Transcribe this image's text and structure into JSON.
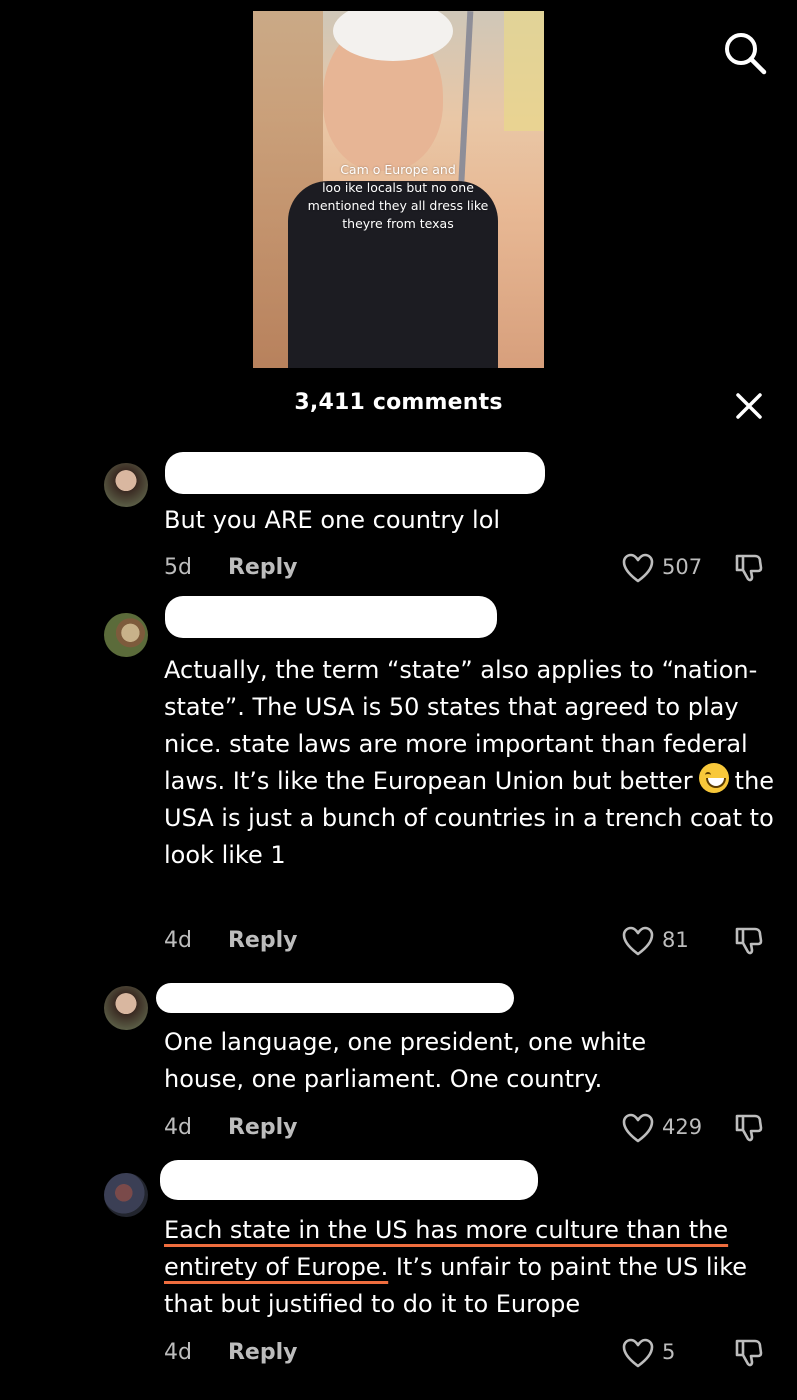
{
  "video": {
    "caption_lines": [
      "Cam  o Europe and",
      "loo  ike locals but no one",
      "mentioned they all dress like",
      "theyre from texas"
    ]
  },
  "header": {
    "comments_count": "3,411 comments"
  },
  "comments": [
    {
      "text": "But you ARE one country lol",
      "age": "5d",
      "reply": "Reply",
      "likes": "507"
    },
    {
      "text_part1": "Actually, the term “state” also applies to “nation-state”. The USA is 50 states that agreed to play nice. state laws are more important than federal laws. It’s like the European Union but better",
      "emoji": "grinning-face",
      "text_part2": "the USA is just a bunch of countries in a trench coat to look like 1",
      "age": "4d",
      "reply": "Reply",
      "likes": "81"
    },
    {
      "text": "One language, one president, one white house, one parliament. One country.",
      "age": "4d",
      "reply": "Reply",
      "likes": "429"
    },
    {
      "text_underlined": "Each state in the US has more culture than the entirety of Europe.",
      "text_rest": "It’s unfair to paint the US like that but justified to do it to Europe",
      "age": "4d",
      "reply": "Reply",
      "likes": "5"
    }
  ],
  "colors": {
    "background": "#000000",
    "underline_accent": "#ef6d3e",
    "meta_text": "#bdbdbd"
  }
}
